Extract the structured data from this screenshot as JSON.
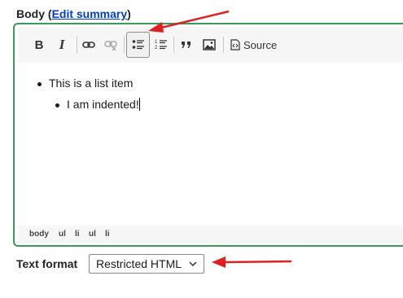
{
  "field": {
    "label_prefix": "Body (",
    "link_text": "Edit summary",
    "label_suffix": ")"
  },
  "toolbar": {
    "source_label": "Source",
    "buttons": [
      "bold-icon",
      "italic-icon",
      "link-icon",
      "unlink-icon",
      "bulleted-list-icon",
      "numbered-list-icon",
      "blockquote-icon",
      "image-icon",
      "source-icon"
    ],
    "active": "bulleted-list-icon"
  },
  "content": {
    "items": [
      {
        "text": "This is a list item",
        "children": [
          {
            "text": "I am indented!"
          }
        ]
      }
    ]
  },
  "statusbar": {
    "path": [
      "body",
      "ul",
      "li",
      "ul",
      "li"
    ]
  },
  "text_format": {
    "label": "Text format",
    "selected": "Restricted HTML"
  },
  "colors": {
    "editor_border": "#3a9a5a",
    "link": "#003ecc",
    "annotation_arrow": "#e02020"
  }
}
